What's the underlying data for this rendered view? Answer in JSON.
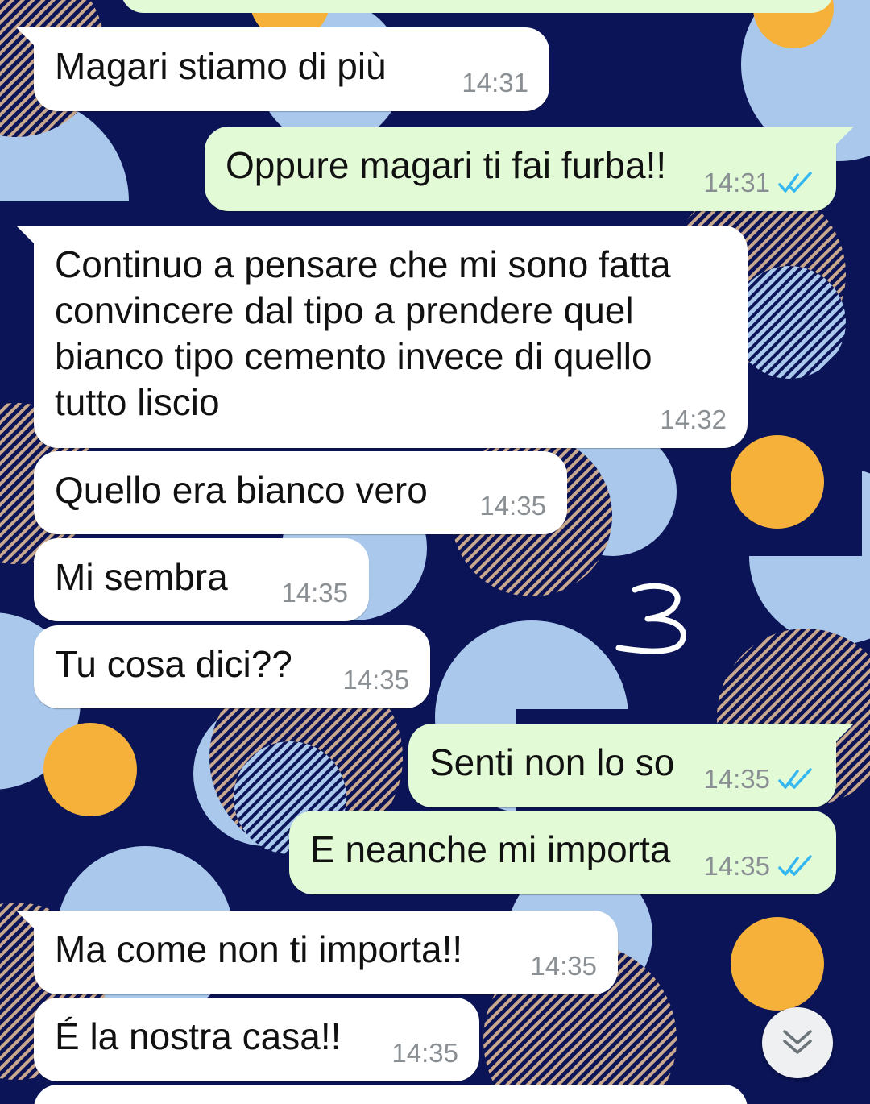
{
  "colors": {
    "wallpaper_navy": "#0b1456",
    "wallpaper_light_blue": "#a9c8ec",
    "wallpaper_orange": "#f6b13a",
    "incoming_bubble": "#ffffff",
    "outgoing_bubble": "#e2fbd6",
    "read_ticks": "#34b7f1",
    "timestamp": "#8a8f94"
  },
  "messages": [
    {
      "direction": "in",
      "text": "Magari stiamo di più",
      "time": "14:31"
    },
    {
      "direction": "out",
      "text": "Oppure magari ti fai furba!!",
      "time": "14:31",
      "status": "read"
    },
    {
      "direction": "in",
      "text": "Continuo a pensare che mi sono fatta\nconvincere dal tipo a prendere quel\nbianco tipo cemento invece di quello\ntutto liscio",
      "time": "14:32"
    },
    {
      "direction": "in",
      "text": "Quello era bianco vero",
      "time": "14:35"
    },
    {
      "direction": "in",
      "text": "Mi sembra",
      "time": "14:35"
    },
    {
      "direction": "in",
      "text": "Tu cosa dici??",
      "time": "14:35"
    },
    {
      "direction": "out",
      "text": "Senti non lo so",
      "time": "14:35",
      "status": "read"
    },
    {
      "direction": "out",
      "text": "E neanche mi importa",
      "time": "14:35",
      "status": "read"
    },
    {
      "direction": "in",
      "text": "Ma come non ti importa!!",
      "time": "14:35"
    },
    {
      "direction": "in",
      "text": "É la nostra casa!!",
      "time": "14:35"
    }
  ],
  "annotation": "3",
  "scroll_to_bottom": {
    "icon": "double-chevron-down-icon"
  }
}
